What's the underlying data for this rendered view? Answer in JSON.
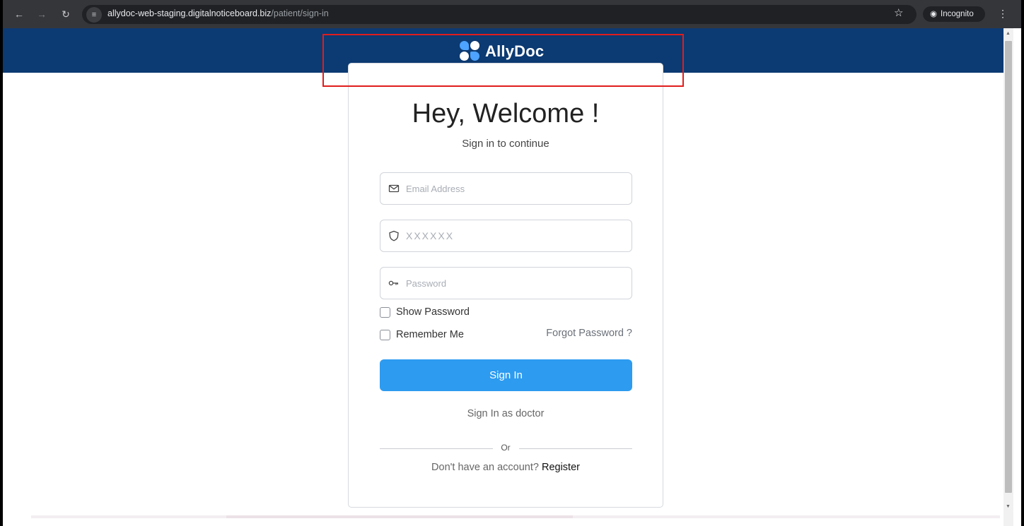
{
  "browser": {
    "url_host": "allydoc-web-staging.digitalnoticeboard.biz",
    "url_path": "/patient/sign-in",
    "incognito_label": "Incognito"
  },
  "brand": {
    "name": "AllyDoc",
    "header_color": "#0c3a72",
    "accent_color": "#2d9bf0"
  },
  "form": {
    "title": "Hey, Welcome !",
    "subtitle": "Sign in to continue",
    "email_placeholder": "Email Address",
    "code_placeholder": "XXXXXX",
    "password_placeholder": "Password",
    "show_password_label": "Show Password",
    "remember_me_label": "Remember Me",
    "forgot_password_label": "Forgot Password ?",
    "sign_in_button": "Sign In",
    "doctor_link": "Sign In as doctor",
    "or_text": "Or",
    "no_account_text": "Don't have an account?",
    "register_link": "Register"
  }
}
